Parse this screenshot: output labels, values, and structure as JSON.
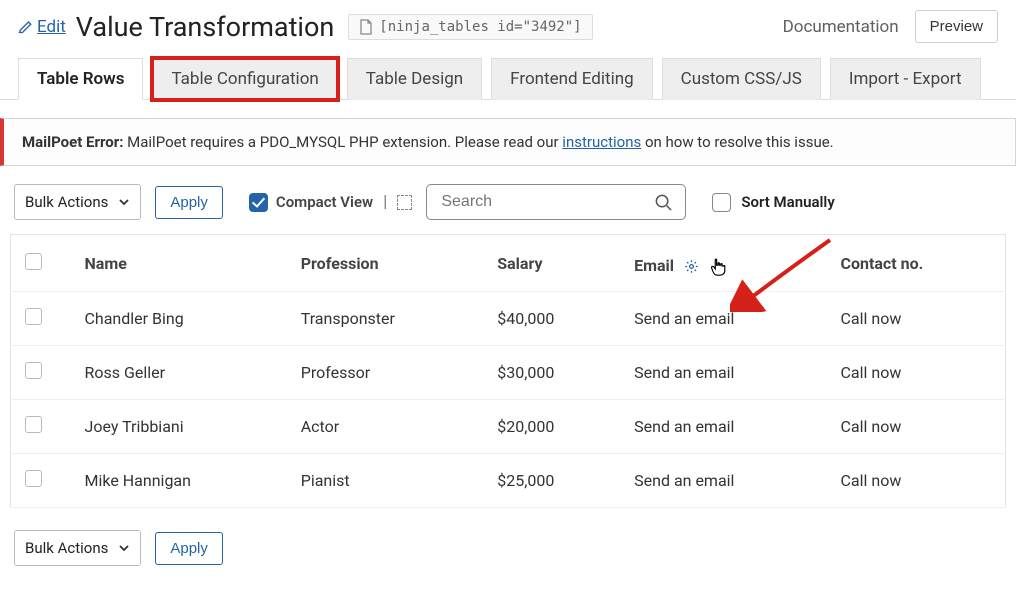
{
  "header": {
    "edit_label": "Edit",
    "title": "Value Transformation",
    "shortcode": "[ninja_tables id=\"3492\"]",
    "documentation_label": "Documentation",
    "preview_label": "Preview"
  },
  "tabs": [
    {
      "label": "Table Rows",
      "active": true,
      "highlight": false
    },
    {
      "label": "Table Configuration",
      "active": false,
      "highlight": true
    },
    {
      "label": "Table Design",
      "active": false,
      "highlight": false
    },
    {
      "label": "Frontend Editing",
      "active": false,
      "highlight": false
    },
    {
      "label": "Custom CSS/JS",
      "active": false,
      "highlight": false
    },
    {
      "label": "Import - Export",
      "active": false,
      "highlight": false
    }
  ],
  "alert": {
    "title": "MailPoet Error:",
    "pre_text": " MailPoet requires a PDO_MYSQL PHP extension. Please read our ",
    "link_text": "instructions",
    "post_text": " on how to resolve this issue."
  },
  "toolbar": {
    "bulk_label": "Bulk Actions",
    "apply_label": "Apply",
    "compact_label": "Compact View",
    "search_placeholder": "Search",
    "sort_label": "Sort Manually"
  },
  "table": {
    "columns": [
      "Name",
      "Profession",
      "Salary",
      "Email",
      "Contact no."
    ],
    "rows": [
      {
        "name": "Chandler Bing",
        "profession": "Transponster",
        "salary": "$40,000",
        "email": "Send an email",
        "contact": "Call now"
      },
      {
        "name": "Ross Geller",
        "profession": "Professor",
        "salary": "$30,000",
        "email": "Send an email",
        "contact": "Call now"
      },
      {
        "name": "Joey Tribbiani",
        "profession": "Actor",
        "salary": "$20,000",
        "email": "Send an email",
        "contact": "Call now"
      },
      {
        "name": "Mike Hannigan",
        "profession": "Pianist",
        "salary": "$25,000",
        "email": "Send an email",
        "contact": "Call now"
      }
    ]
  }
}
